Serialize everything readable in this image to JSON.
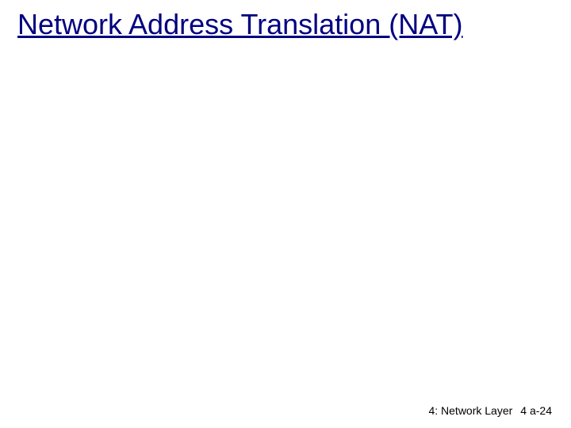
{
  "title": "Network Address Translation (NAT)",
  "footer": {
    "section": "4: Network Layer",
    "page": "4 a-24"
  }
}
